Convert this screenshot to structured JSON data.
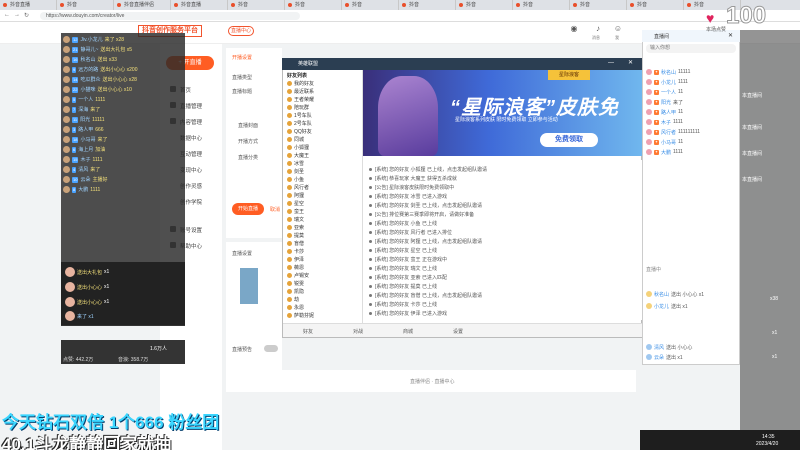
{
  "browser": {
    "tabs": [
      "抖音直播",
      "抖音",
      "抖音直播伴侣",
      "抖音直播",
      "抖音",
      "抖音",
      "抖音",
      "抖音",
      "抖音",
      "抖音",
      "抖音",
      "抖音",
      "抖音"
    ],
    "url": "https://www.douyin.com/creator/live"
  },
  "header": {
    "logo": "抖音创作服务平台",
    "head_button": "直播中心",
    "icons": [
      {
        "name": "eye-icon",
        "label": ""
      },
      {
        "name": "bell-icon",
        "label": "消息"
      },
      {
        "name": "user-icon",
        "label": "我"
      }
    ]
  },
  "leftnav": {
    "start_live": "+ 开直播",
    "items": [
      "首页",
      "直播管理",
      "内容管理",
      "数据中心",
      "互动管理",
      "变现中心",
      "创作灵感",
      "创作学院",
      "账号设置",
      "帮助中心"
    ]
  },
  "form": {
    "section1": "开播设置",
    "rows": [
      "直播类型",
      "直播标题",
      "直播封面",
      "开播方式",
      "直播分类"
    ],
    "submit": "开始直播",
    "reset": "取消",
    "section2": "直播设置",
    "toggle_label": "直播预告",
    "footer": "直播伴侣 · 直播中心"
  },
  "danmu_panel": {
    "rows": [
      {
        "name": "Jiv.小龙儿",
        "level": "12",
        "text": "来了 x28"
      },
      {
        "name": "静哥儿~",
        "level": "21",
        "text": "送出大礼包 x5"
      },
      {
        "name": "秋名山",
        "level": "16",
        "text": "送出 x33"
      },
      {
        "name": "远方的路",
        "level": "9",
        "text": "送出小心心 x200"
      },
      {
        "name": "吃瓜群众",
        "level": "14",
        "text": "送出小心心 x28"
      },
      {
        "name": "小猫咪",
        "level": "22",
        "text": "送出小心心 x10"
      },
      {
        "name": "一个人",
        "level": "5",
        "text": "1111"
      },
      {
        "name": "深海",
        "level": "7",
        "text": "来了"
      },
      {
        "name": "阳光",
        "level": "11",
        "text": "11111"
      },
      {
        "name": "路人甲",
        "level": "3",
        "text": "666"
      },
      {
        "name": "小马哥",
        "level": "18",
        "text": "来了"
      },
      {
        "name": "海上月",
        "level": "6",
        "text": "加油"
      },
      {
        "name": "木子",
        "level": "15",
        "text": "1111"
      },
      {
        "name": "清风",
        "level": "4",
        "text": "来了"
      },
      {
        "name": "云朵",
        "level": "10",
        "text": "主播好"
      },
      {
        "name": "大鹏",
        "level": "8",
        "text": "1111"
      }
    ],
    "gifts": [
      {
        "name": "送出大礼包",
        "count": "x1"
      },
      {
        "name": "送出小心心",
        "count": "x1"
      },
      {
        "name": "送出小心心",
        "count": "x1"
      },
      {
        "name": "来了 x1",
        "count": ""
      }
    ],
    "stats": {
      "likes": "点赞: 442.2万",
      "views": "音浪: 358.7万",
      "online": "1.6万人"
    }
  },
  "game": {
    "title": "英雄联盟",
    "friends_header": "好友列表",
    "friends": [
      "我的好友",
      "最近联系",
      "王者荣耀",
      "陪玩群",
      "1号车队",
      "2号车队",
      "QQ好友",
      "同城",
      "小狐狸",
      "大魔王",
      "冰雪",
      "剑圣",
      "小鱼",
      "风行者",
      "阿狸",
      "星空",
      "蛮王",
      "瑞文",
      "亚索",
      "提莫",
      "盲僧",
      "卡莎",
      "伊泽",
      "薇恩",
      "卢锡安",
      "锐雯",
      "凯隐",
      "劫",
      "永恩",
      "萨勒芬妮"
    ],
    "banner_tag": "星际浪客",
    "banner_title": "“星际浪客”皮肤免",
    "banner_sub": "星际浪客系列皮肤 限时免费领取 立即参与活动",
    "banner_button": "免费领取",
    "chat_lines": [
      "[系统] 您的好友 小狐狸 已上线，点击发起组队邀请",
      "[系统] 恭喜玩家 大魔王 获得五杀成就",
      "[公告] 星际浪客皮肤限时免费领取中",
      "[系统] 您的好友 冰雪 已进入游戏",
      "[系统] 您的好友 剑圣 已上线，点击发起组队邀请",
      "[公告] 排位赛第三赛季即将开启，请做好准备",
      "[系统] 您的好友 小鱼 已上线",
      "[系统] 您的好友 风行者 已进入排位",
      "[系统] 您的好友 阿狸 已上线，点击发起组队邀请",
      "[系统] 您的好友 星空 已上线",
      "[系统] 您的好友 蛮王 正在游戏中",
      "[系统] 您的好友 瑞文 已上线",
      "[系统] 您的好友 亚索 已进入匹配",
      "[系统] 您的好友 提莫 已上线",
      "[系统] 您的好友 盲僧 已上线，点击发起组队邀请",
      "[系统] 您的好友 卡莎 已上线",
      "[系统] 您的好友 伊泽 已进入游戏"
    ],
    "bottom": [
      "好友",
      "对战",
      "商城",
      "设置"
    ]
  },
  "rchat": {
    "title": "直播间",
    "search": "输入你想",
    "rows": [
      {
        "name": "秋名山",
        "text": "11111"
      },
      {
        "name": "小龙儿",
        "text": "1111"
      },
      {
        "name": "一个人",
        "text": "11"
      },
      {
        "name": "阳光",
        "text": "来了"
      },
      {
        "name": "路人甲",
        "text": "11"
      },
      {
        "name": "木子",
        "text": "1111"
      },
      {
        "name": "风行者",
        "text": "111111111"
      },
      {
        "name": "小马哥",
        "text": "11"
      },
      {
        "name": "大鹏",
        "text": "1111"
      }
    ],
    "mid": "直播中",
    "bottom_rows": [
      {
        "name": "秋名山",
        "text": "送出 小心心 x1"
      },
      {
        "name": "小龙儿",
        "text": "送出 x1"
      },
      {
        "name": "清风",
        "text": "送出 小心心"
      },
      {
        "name": "云朵",
        "text": "送出 x1"
      }
    ]
  },
  "top_right": {
    "heart_count": "100",
    "label": "本场点赞"
  },
  "far_right": [
    "本直播间",
    "本直播间",
    "本直播间",
    "本直播间",
    "x38",
    "x1",
    "x1"
  ],
  "overlay": {
    "line1": "今天钻石双倍 1个666 粉丝团",
    "line2": "40.1斗龙静静回家就抽"
  },
  "clock": {
    "time": "14:35",
    "date": "2023/4/20"
  }
}
